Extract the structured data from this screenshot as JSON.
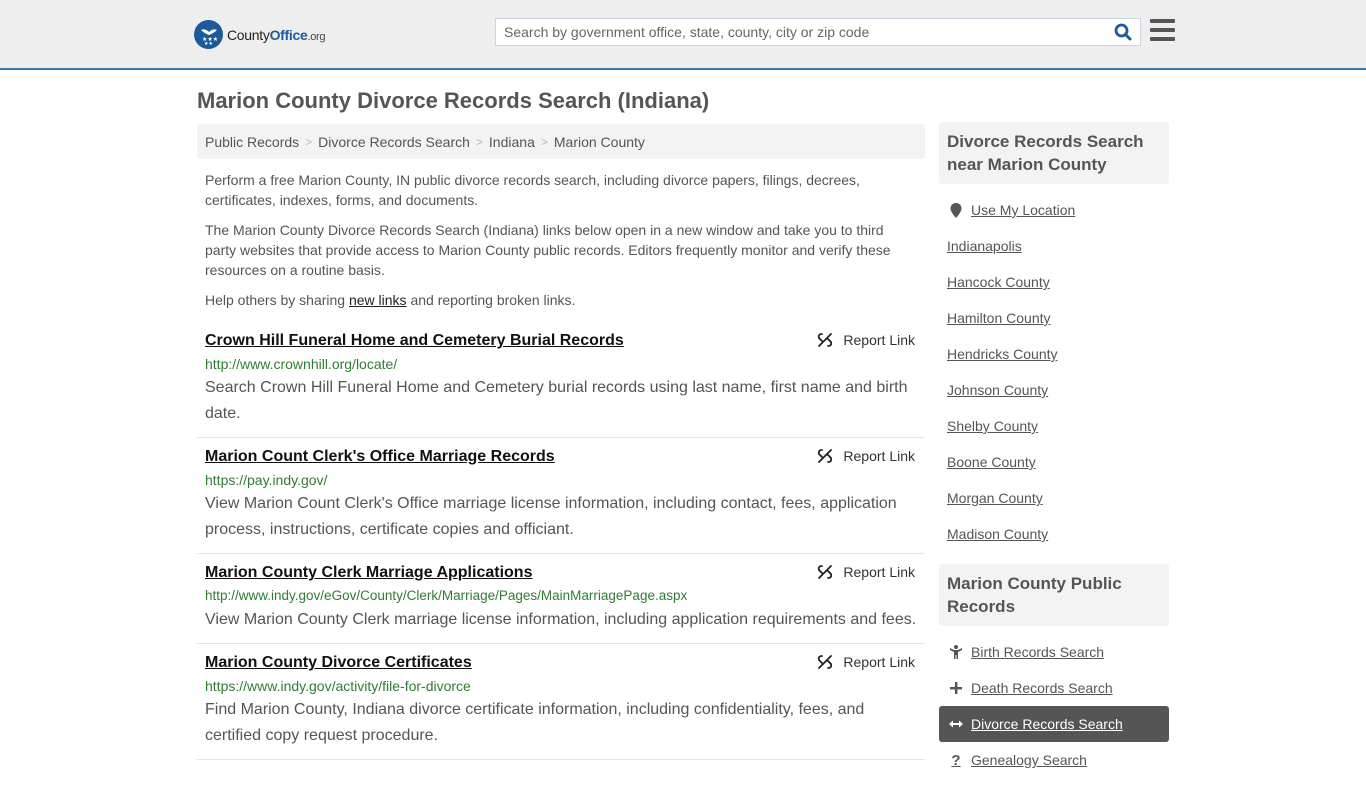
{
  "header": {
    "logo": {
      "name": "County",
      "name_bold": "Office",
      "tld": ".org"
    },
    "search": {
      "placeholder": "Search by government office, state, county, city or zip code",
      "value": ""
    },
    "accent_color": "#3a7aa8",
    "brand_color": "#1d5a9a"
  },
  "page": {
    "title": "Marion County Divorce Records Search (Indiana)"
  },
  "breadcrumb": [
    {
      "label": "Public Records"
    },
    {
      "label": "Divorce Records Search"
    },
    {
      "label": "Indiana"
    },
    {
      "label": "Marion County"
    }
  ],
  "intro": {
    "p1": "Perform a free Marion County, IN public divorce records search, including divorce papers, filings, decrees, certificates, indexes, forms, and documents.",
    "p2": "The Marion County Divorce Records Search (Indiana) links below open in a new window and take you to third party websites that provide access to Marion County public records. Editors frequently monitor and verify these resources on a routine basis.",
    "p3_before": "Help others by sharing ",
    "p3_link": "new links",
    "p3_after": " and reporting broken links."
  },
  "results": [
    {
      "title": "Crown Hill Funeral Home and Cemetery Burial Records",
      "url": "http://www.crownhill.org/locate/",
      "description": "Search Crown Hill Funeral Home and Cemetery burial records using last name, first name and birth date.",
      "report_label": "Report Link"
    },
    {
      "title": "Marion Count Clerk's Office Marriage Records",
      "url": "https://pay.indy.gov/",
      "description": "View Marion Count Clerk's Office marriage license information, including contact, fees, application process, instructions, certificate copies and officiant.",
      "report_label": "Report Link"
    },
    {
      "title": "Marion County Clerk Marriage Applications",
      "url": "http://www.indy.gov/eGov/County/Clerk/Marriage/Pages/MainMarriagePage.aspx",
      "description": "View Marion County Clerk marriage license information, including application requirements and fees.",
      "report_label": "Report Link"
    },
    {
      "title": "Marion County Divorce Certificates",
      "url": "https://www.indy.gov/activity/file-for-divorce",
      "description": "Find Marion County, Indiana divorce certificate information, including confidentiality, fees, and certified copy request procedure.",
      "report_label": "Report Link"
    }
  ],
  "sidebar": {
    "nearby": {
      "heading": "Divorce Records Search near Marion County",
      "use_location": "Use My Location",
      "links": [
        "Indianapolis",
        "Hancock County",
        "Hamilton County",
        "Hendricks County",
        "Johnson County",
        "Shelby County",
        "Boone County",
        "Morgan County",
        "Madison County"
      ]
    },
    "public_records": {
      "heading": "Marion County Public Records",
      "links": [
        {
          "label": "Birth Records Search",
          "icon": "child-icon"
        },
        {
          "label": "Death Records Search",
          "icon": "plus-icon"
        },
        {
          "label": "Divorce Records Search",
          "icon": "arrows-horizontal-icon",
          "active": true
        },
        {
          "label": "Genealogy Search",
          "icon": "question-icon"
        }
      ]
    }
  }
}
